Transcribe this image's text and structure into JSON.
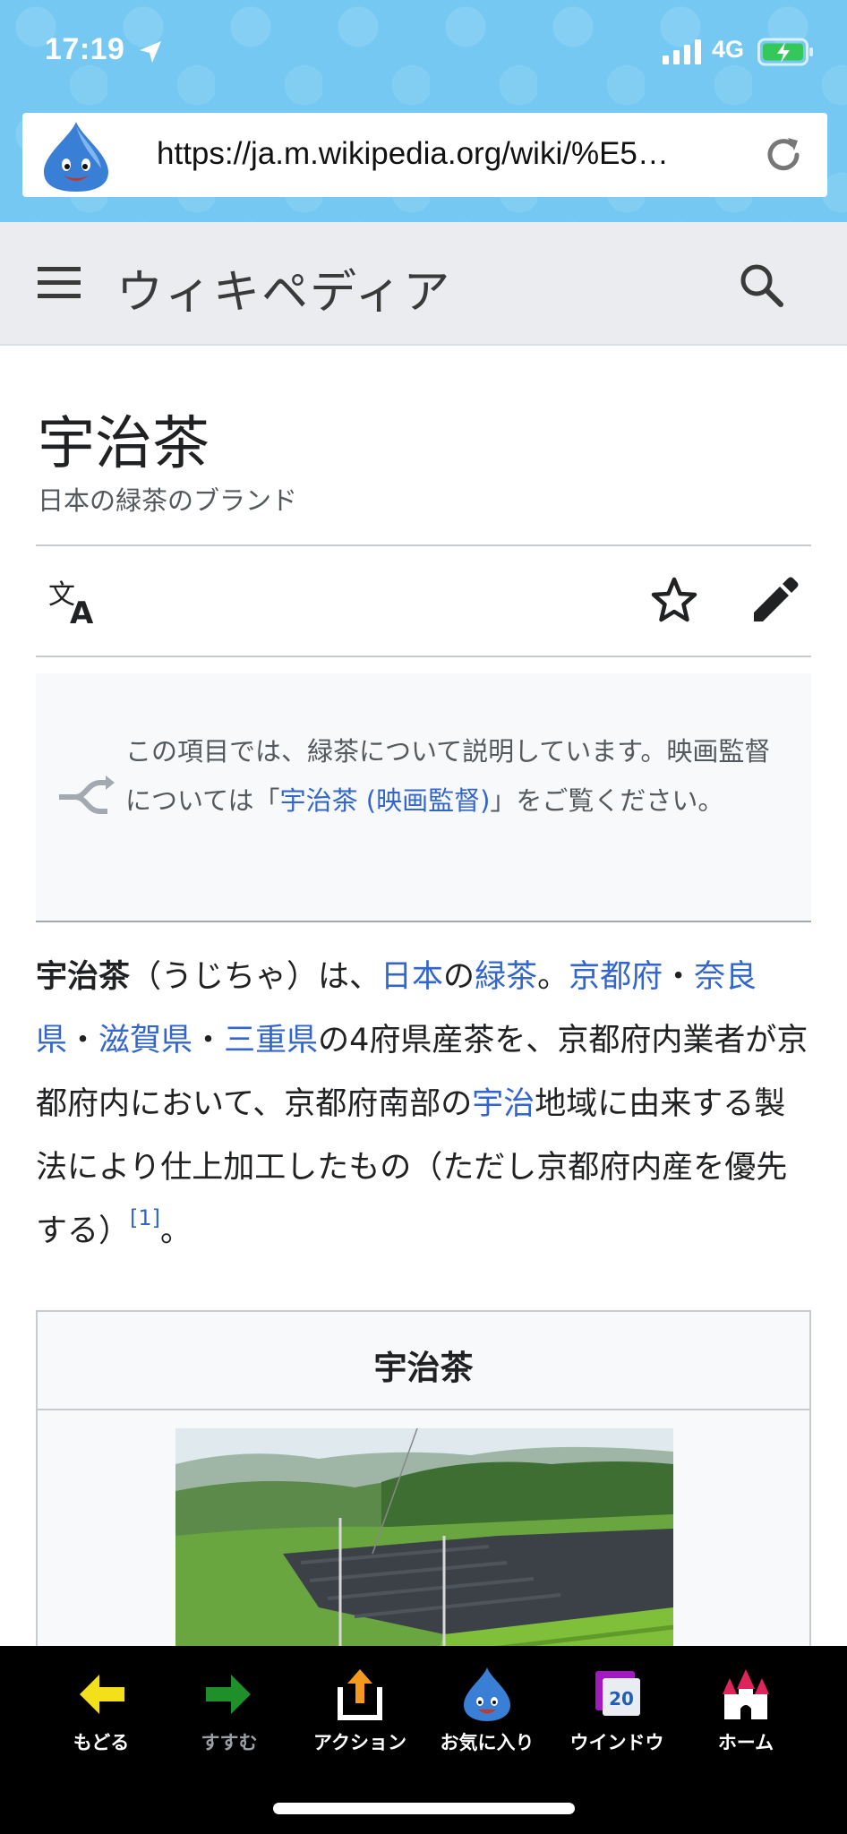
{
  "status_bar": {
    "time": "17:19",
    "network": "4G"
  },
  "browser": {
    "url": "https://ja.m.wikipedia.org/wiki/%E5…"
  },
  "wiki_header": {
    "logo_text": "ウィキペディア"
  },
  "article": {
    "title": "宇治茶",
    "subtitle": "日本の緑茶のブランド",
    "hatnote": {
      "prefix": "この項目では、緑茶について説明しています。映画監督については「",
      "link": "宇治茶 (映画監督)",
      "suffix": "」をご覧ください。"
    },
    "lead": {
      "bold": "宇治茶",
      "t1": "（うじちゃ）は、",
      "l_nihon": "日本",
      "t2": "の",
      "l_ryokucha": "緑茶",
      "t3": "。",
      "l_kyoto": "京都府",
      "t4": "・",
      "l_nara": "奈良県",
      "t5": "・",
      "l_shiga": "滋賀県",
      "t6": "・",
      "l_mie": "三重県",
      "t7": "の4府県産茶を、京都府内業者が京都府内において、京都府南部の",
      "l_uji": "宇治",
      "t8": "地域に由来する製法により仕上加工したもの（ただし京都府内産を優先する）",
      "ref": "[1]",
      "t9": "。"
    },
    "infobox": {
      "title": "宇治茶"
    }
  },
  "toolbar": {
    "back": "もどる",
    "forward": "すすむ",
    "action": "アクション",
    "favorites": "お気に入り",
    "windows": "ウインドウ",
    "window_count": "20",
    "home": "ホーム"
  },
  "colors": {
    "link": "#3366cc",
    "chrome_bg": "#74c8f2",
    "header_bg": "#eaecf0"
  }
}
